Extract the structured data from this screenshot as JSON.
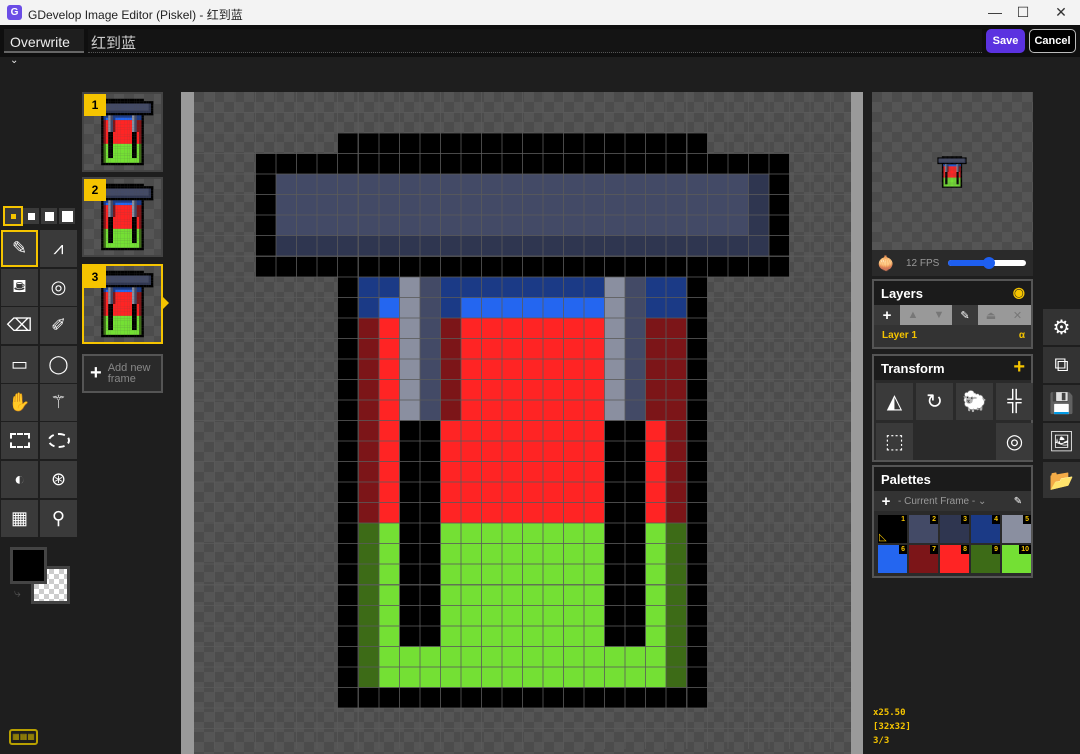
{
  "window": {
    "title": "GDevelop Image Editor (Piskel) - 红到蓝",
    "minimize": "—",
    "maximize": "☐",
    "close": "✕"
  },
  "topbar": {
    "mode": "Overwrite",
    "name_value": "红到蓝",
    "save": "Save",
    "cancel": "Cancel"
  },
  "frames": [
    {
      "num": "1"
    },
    {
      "num": "2"
    },
    {
      "num": "3"
    }
  ],
  "add_frame": "Add new frame",
  "preview": {
    "fps": "12 FPS",
    "fps_value": 12
  },
  "layers": {
    "title": "Layers",
    "items": [
      {
        "name": "Layer 1",
        "alpha": "α"
      }
    ]
  },
  "transform": {
    "title": "Transform"
  },
  "palettes": {
    "title": "Palettes",
    "selected": "- Current Frame -",
    "colors": [
      {
        "n": "1",
        "c": "#000000"
      },
      {
        "n": "2",
        "c": "#434a66"
      },
      {
        "n": "3",
        "c": "#2f3650"
      },
      {
        "n": "4",
        "c": "#1b3a86"
      },
      {
        "n": "5",
        "c": "#8a8fa0"
      },
      {
        "n": "6",
        "c": "#2466f0"
      },
      {
        "n": "7",
        "c": "#7c1518"
      },
      {
        "n": "8",
        "c": "#ff2424"
      },
      {
        "n": "9",
        "c": "#3d6b17"
      },
      {
        "n": "10",
        "c": "#74e034"
      }
    ]
  },
  "status": {
    "zoom": "x25.50",
    "size": "[32x32]",
    "frame": "3/3"
  },
  "colors": {
    "primary": "#000000",
    "accent": "#f5c400",
    "save": "#5b32e0"
  },
  "sprite": {
    "palette": {
      "k": "#000000",
      "a": "#434a66",
      "b": "#2f3650",
      "d": "#1b3a86",
      "g": "#8a8fa0",
      "B": "#2466f0",
      "r": "#7c1518",
      "R": "#ff2424",
      "v": "#3d6b17",
      "G": "#74e034"
    },
    "rows": [
      "................................",
      "................................",
      ".......kkkkkkkkkkkkkkkkkk.......",
      "...kkkkkkkkkkkkkkkkkkkkkkkkkk...",
      "...kaaaaaaaaaaaaaaaaaaaaaaabk...",
      "...kaaaaaaaaaaaaaaaaaaaaaaabk...",
      "...kaaaaaaaaaaaaaaaaaaaaaaabk...",
      "...kbbbbbbbbbbbbbbbbbbbbbbbbk...",
      "...kkkkkkkkkkkkkkkkkkkkkkkkkk...",
      ".......kddgaddddddddgaddk.......",
      ".......kdBgadBBBBBBBgaddk.......",
      ".......krRgarRRRRRRRgarrk.......",
      ".......krRgarRRRRRRRgarrk.......",
      ".......krRgarRRRRRRRgarrk.......",
      ".......krRgarRRRRRRRgarrk.......",
      ".......krRgarRRRRRRRgarrk.......",
      ".......krRkkRRRRRRRRkkRrk.......",
      ".......krRkkRRRRRRRRkkRrk.......",
      ".......krRkkRRRRRRRRkkRrk.......",
      ".......krRkkRRRRRRRRkkRrk.......",
      ".......krRkkRRRRRRRRkkRrk.......",
      ".......kvGkkGGGGGGGGkkGvk.......",
      ".......kvGkkGGGGGGGGkkGvk.......",
      ".......kvGkkGGGGGGGGkkGvk.......",
      ".......kvGkkGGGGGGGGkkGvk.......",
      ".......kvGkkGGGGGGGGkkGvk.......",
      ".......kvGkkGGGGGGGGkkGvk.......",
      ".......kvGGGGGGGGGGGGGGvk.......",
      ".......kvGGGGGGGGGGGGGGvk.......",
      ".......kkkkkkkkkkkkkkkkkk.......",
      "................................",
      "................................"
    ]
  }
}
